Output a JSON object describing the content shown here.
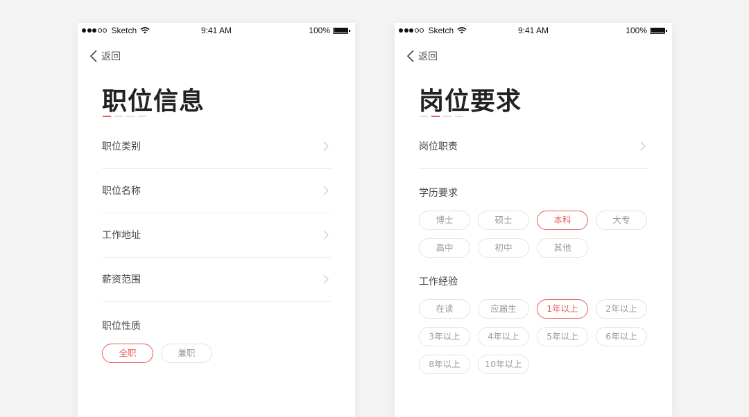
{
  "status_bar": {
    "carrier": "Sketch",
    "time": "9:41 AM",
    "battery": "100%"
  },
  "left_screen": {
    "back_label": "返回",
    "title": "职位信息",
    "rows": [
      {
        "label": "职位类别"
      },
      {
        "label": "职位名称"
      },
      {
        "label": "工作地址"
      },
      {
        "label": "薪资范围"
      }
    ],
    "job_type": {
      "label": "职位性质",
      "options": [
        {
          "label": "全职",
          "selected": true
        },
        {
          "label": "兼职",
          "selected": false
        }
      ]
    }
  },
  "right_screen": {
    "back_label": "返回",
    "title": "岗位要求",
    "row": {
      "label": "岗位职责"
    },
    "education": {
      "label": "学历要求",
      "options": [
        {
          "label": "博士",
          "selected": false
        },
        {
          "label": "硕士",
          "selected": false
        },
        {
          "label": "本科",
          "selected": true
        },
        {
          "label": "大专",
          "selected": false
        },
        {
          "label": "高中",
          "selected": false
        },
        {
          "label": "初中",
          "selected": false
        },
        {
          "label": "其他",
          "selected": false
        }
      ]
    },
    "experience": {
      "label": "工作经验",
      "options": [
        {
          "label": "在读",
          "selected": false
        },
        {
          "label": "应届生",
          "selected": false
        },
        {
          "label": "1年以上",
          "selected": true
        },
        {
          "label": "2年以上",
          "selected": false
        },
        {
          "label": "3年以上",
          "selected": false
        },
        {
          "label": "4年以上",
          "selected": false
        },
        {
          "label": "5年以上",
          "selected": false
        },
        {
          "label": "6年以上",
          "selected": false
        },
        {
          "label": "8年以上",
          "selected": false
        },
        {
          "label": "10年以上",
          "selected": false
        }
      ]
    }
  },
  "steps": {
    "left_active": 1,
    "right_active": 2,
    "count": 4
  },
  "colors": {
    "accent": "#e85b5b",
    "background": "#f3f3f3",
    "chip_border": "#e3e3e3"
  },
  "icons": {
    "back": "chevron-left-icon",
    "row_arrow": "chevron-right-icon",
    "wifi": "wifi-icon",
    "battery": "battery-icon",
    "signal": "signal-dots-icon"
  }
}
